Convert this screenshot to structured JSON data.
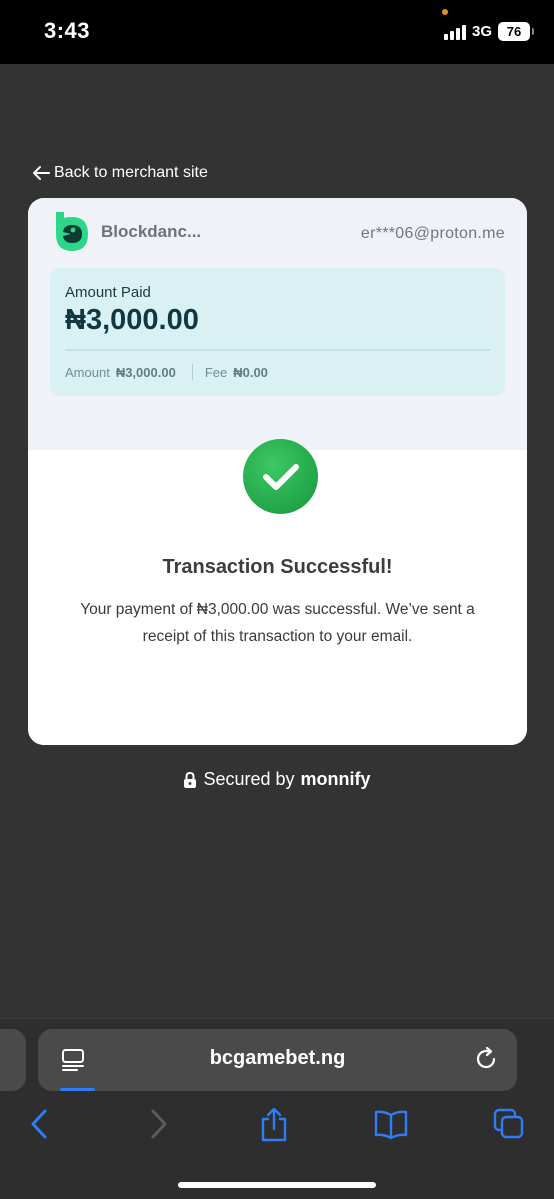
{
  "status_bar": {
    "time": "3:43",
    "network": "3G",
    "battery": "76"
  },
  "back_link": {
    "label": "Back to merchant site"
  },
  "checkout": {
    "merchant_name": "Blockdanc...",
    "user_email": "er***06@proton.me",
    "amount_paid_label": "Amount Paid",
    "amount_paid_value": "₦3,000.00",
    "amount_label": "Amount",
    "amount_value": "₦3,000.00",
    "fee_label": "Fee",
    "fee_value": "₦0.00"
  },
  "result": {
    "title": "Transaction Successful!",
    "message": "Your payment of ₦3,000.00 was successful. We’ve sent a receipt of this transaction to your email."
  },
  "footer": {
    "secured_prefix": "Secured by",
    "secured_brand": "monnify"
  },
  "browser": {
    "url": "bcgamebet.ng"
  },
  "colors": {
    "page_background": "#333333",
    "success_green": "#21a548",
    "amount_box": "#d9f1f3",
    "merchant_logo": "#2fd58a",
    "safari_blue": "#2f7cf6"
  },
  "icons": {
    "back": "arrow-left-icon",
    "logo": "blockdance-logo-icon",
    "success": "checkmark-icon",
    "secured": "lock-icon",
    "reader": "reader-mode-icon",
    "reload": "reload-icon",
    "nav_back": "chevron-left-icon",
    "nav_forward": "chevron-right-icon",
    "share": "share-icon",
    "bookmarks": "bookmarks-icon",
    "tabs": "tabs-icon"
  }
}
